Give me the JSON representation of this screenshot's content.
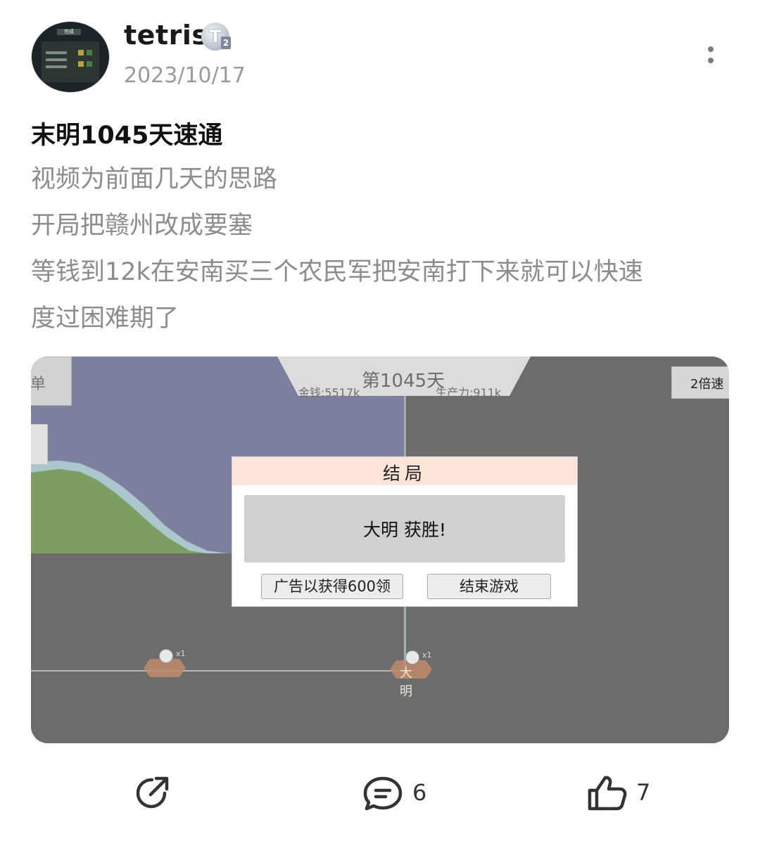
{
  "author": {
    "name": "tetris",
    "badge_letter": "T",
    "badge_sub": "2",
    "date": "2023/10/17",
    "avatar_text": "完成"
  },
  "post": {
    "title": "末明1045天速通",
    "lines": [
      "视频为前面几天的思路",
      "开局把赣州改成要塞",
      "等钱到12k在安南买三个农民军把安南打下来就可以快速",
      "度过困难期了"
    ]
  },
  "game": {
    "day": "第1045天",
    "money": "金钱:5517k",
    "power": "生产力:911k",
    "left_button": "单",
    "speed_button": "2倍速",
    "dialog": {
      "title": "结局",
      "message": "大明 获胜!",
      "ad_button": "广告以获得600领",
      "end_button": "结束游戏"
    },
    "units": [
      {
        "multiplier": "x1",
        "name": ""
      },
      {
        "multiplier": "x1",
        "name": "大明"
      }
    ]
  },
  "actions": {
    "share_icon": "share-icon",
    "comment_icon": "comment-icon",
    "comment_count": "6",
    "like_icon": "thumbs-up-icon",
    "like_count": "7"
  }
}
